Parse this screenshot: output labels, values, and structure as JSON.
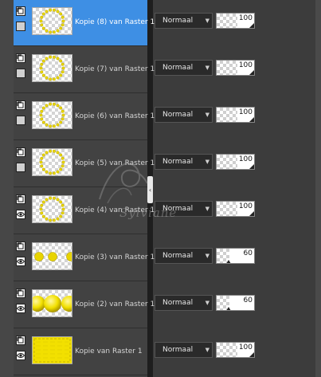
{
  "layers": [
    {
      "name": "Kopie (8) van Raster 1",
      "blend": "Normaal",
      "opacity": "100",
      "opacity_fraction": 1.0,
      "visible": false,
      "selected": true,
      "thumb": "ring"
    },
    {
      "name": "Kopie (7) van Raster 1",
      "blend": "Normaal",
      "opacity": "100",
      "opacity_fraction": 1.0,
      "visible": false,
      "selected": false,
      "thumb": "ring"
    },
    {
      "name": "Kopie (6) van Raster 1",
      "blend": "Normaal",
      "opacity": "100",
      "opacity_fraction": 1.0,
      "visible": false,
      "selected": false,
      "thumb": "ring"
    },
    {
      "name": "Kopie (5) van Raster 1",
      "blend": "Normaal",
      "opacity": "100",
      "opacity_fraction": 1.0,
      "visible": false,
      "selected": false,
      "thumb": "ring"
    },
    {
      "name": "Kopie (4) van Raster 1",
      "blend": "Normaal",
      "opacity": "100",
      "opacity_fraction": 1.0,
      "visible": true,
      "selected": false,
      "thumb": "ring"
    },
    {
      "name": "Kopie (3) van Raster 1",
      "blend": "Normaal",
      "opacity": "60",
      "opacity_fraction": 0.6,
      "visible": true,
      "selected": false,
      "thumb": "dots"
    },
    {
      "name": "Kopie (2) van Raster 1",
      "blend": "Normaal",
      "opacity": "60",
      "opacity_fraction": 0.6,
      "visible": true,
      "selected": false,
      "thumb": "spheres"
    },
    {
      "name": "Kopie van Raster 1",
      "blend": "Normaal",
      "opacity": "100",
      "opacity_fraction": 1.0,
      "visible": true,
      "selected": false,
      "thumb": "solid"
    }
  ],
  "watermark": "Sylviane",
  "colors": {
    "selected": "#3e8fe4",
    "thumb_yellow": "#f2e000",
    "ring_yellow": "#e8d400"
  },
  "icons": {
    "layer_type": "raster-layer-icon",
    "visible": "eye-icon",
    "hidden": "visibility-toggle-icon",
    "dropdown": "chevron-down-icon",
    "splitter": "chevron-left-icon"
  }
}
